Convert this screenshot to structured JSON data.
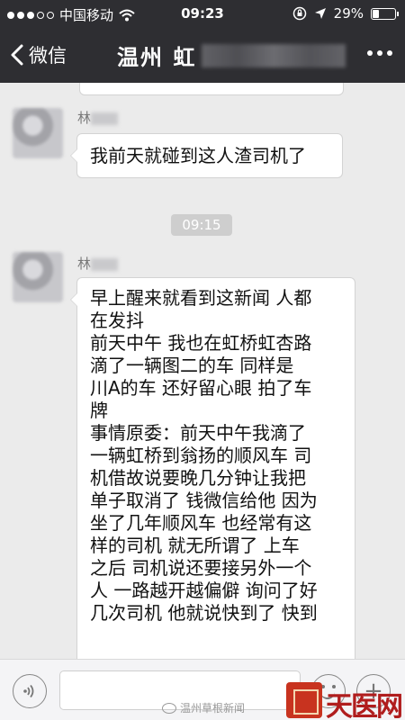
{
  "status_bar": {
    "carrier": "中国移动",
    "time": "09:23",
    "battery": "29%",
    "battery_level": 0.29,
    "signal_bars": 3
  },
  "nav": {
    "back_label": "微信",
    "title": "温州 虹"
  },
  "messages": [
    {
      "sender": "林",
      "lines": [
        "我前天就碰到这人渣司机了"
      ]
    },
    {
      "timestamp": "09:15"
    },
    {
      "sender": "林",
      "lines": [
        "早上醒来就看到这新闻  人都",
        "在发抖",
        "前天中午 我也在虹桥虹杏路",
        "滴了一辆图二的车   同样是",
        "川A的车 还好留心眼 拍了车",
        "牌",
        "事情原委：前天中午我滴了",
        "一辆虹桥到翁扬的顺风车 司",
        "机借故说要晚几分钟让我把",
        "单子取消了 钱微信给他 因为",
        "坐了几年顺风车 也经常有这",
        "样的司机 就无所谓了   上车",
        "之后 司机说还要接另外一个",
        "人 一路越开越偏僻 询问了好",
        "几次司机 他就说快到了 快到"
      ]
    }
  ],
  "watermark": {
    "source": "温州草根新闻",
    "brand": "天医网"
  },
  "icons": {
    "back": "chevron-left-icon",
    "more": "more-dots-icon",
    "voice": "voice-icon",
    "emoji": "emoji-icon",
    "plus": "plus-icon"
  }
}
